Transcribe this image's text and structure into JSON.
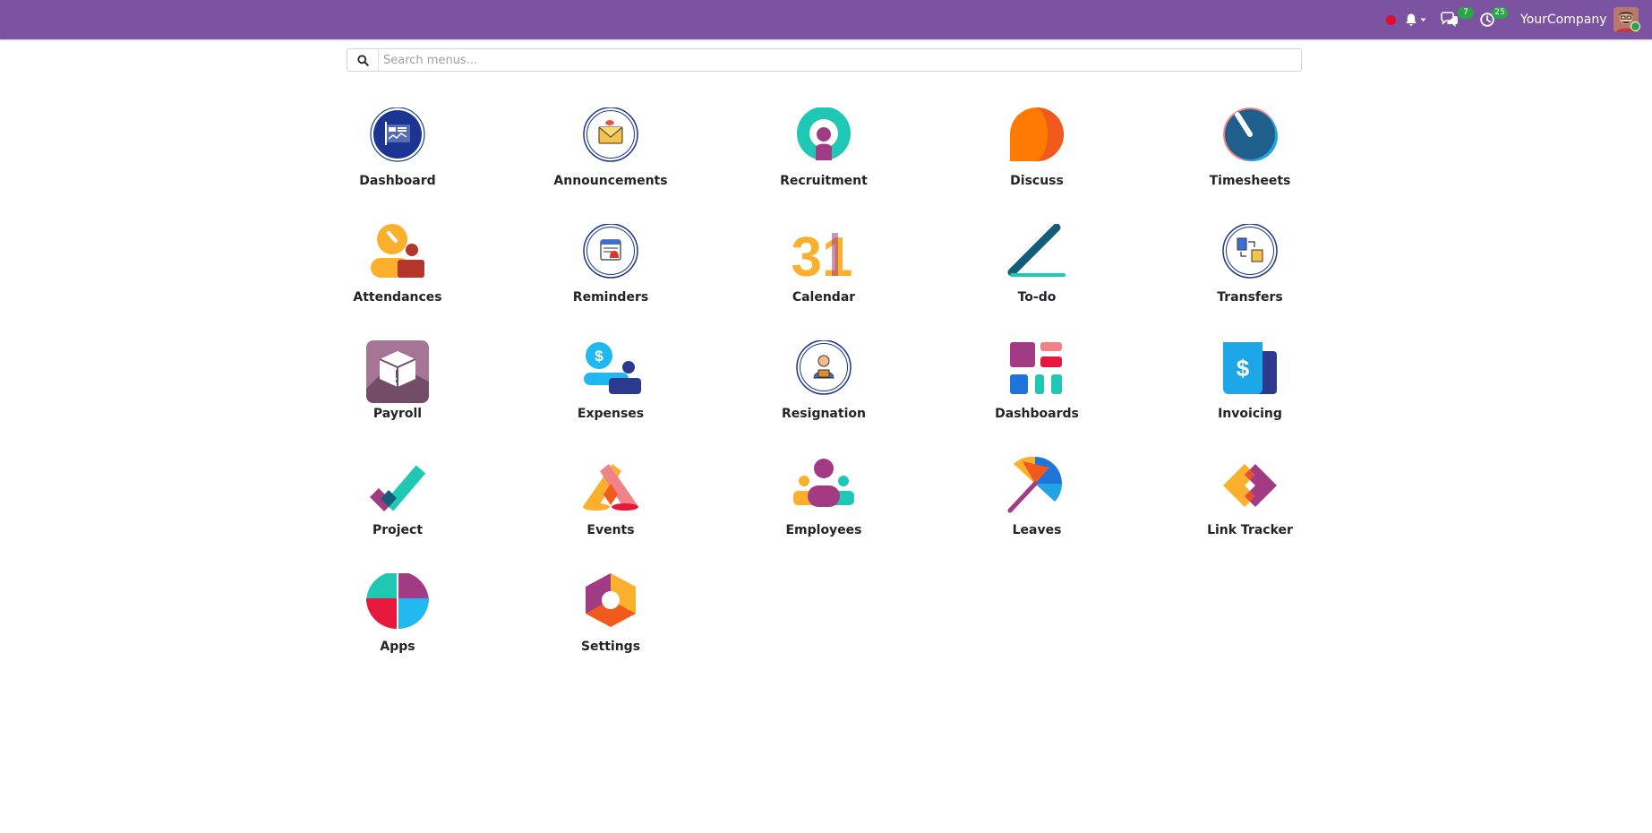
{
  "topbar": {
    "company": "YourCompany",
    "messages_count": "7",
    "activities_count": "25",
    "bar_color": "#7b53a0"
  },
  "search": {
    "placeholder": "Search menus..."
  },
  "apps": [
    {
      "label": "Dashboard",
      "icon": "dashboard-icon"
    },
    {
      "label": "Announcements",
      "icon": "announcements-icon"
    },
    {
      "label": "Recruitment",
      "icon": "recruitment-icon"
    },
    {
      "label": "Discuss",
      "icon": "discuss-icon"
    },
    {
      "label": "Timesheets",
      "icon": "timesheets-icon"
    },
    {
      "label": "Attendances",
      "icon": "attendances-icon"
    },
    {
      "label": "Reminders",
      "icon": "reminders-icon"
    },
    {
      "label": "Calendar",
      "icon": "calendar-icon",
      "icon_text": "31"
    },
    {
      "label": "To-do",
      "icon": "todo-icon"
    },
    {
      "label": "Transfers",
      "icon": "transfers-icon"
    },
    {
      "label": "Payroll",
      "icon": "payroll-icon"
    },
    {
      "label": "Expenses",
      "icon": "expenses-icon"
    },
    {
      "label": "Resignation",
      "icon": "resignation-icon"
    },
    {
      "label": "Dashboards",
      "icon": "dashboards-icon"
    },
    {
      "label": "Invoicing",
      "icon": "invoicing-icon"
    },
    {
      "label": "Project",
      "icon": "project-icon"
    },
    {
      "label": "Events",
      "icon": "events-icon"
    },
    {
      "label": "Employees",
      "icon": "employees-icon"
    },
    {
      "label": "Leaves",
      "icon": "leaves-icon"
    },
    {
      "label": "Link Tracker",
      "icon": "link-tracker-icon"
    },
    {
      "label": "Apps",
      "icon": "apps-icon"
    },
    {
      "label": "Settings",
      "icon": "settings-icon"
    }
  ]
}
